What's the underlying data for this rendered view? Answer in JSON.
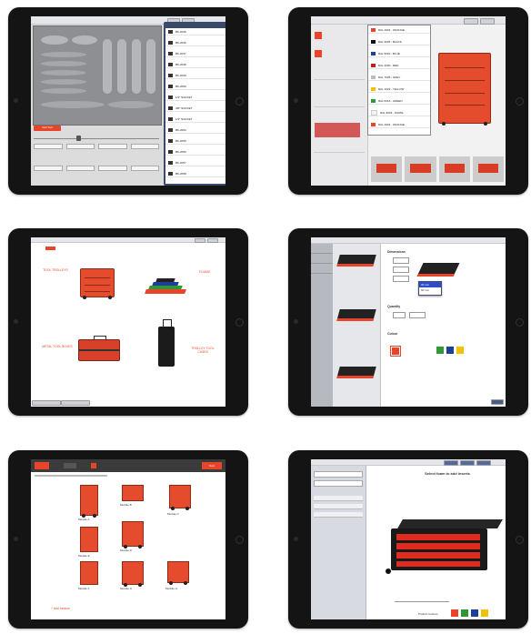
{
  "colors": {
    "frame": "#141414",
    "accent": "#e8442a",
    "panel": "#e5e6ea"
  },
  "screens": {
    "s1": {
      "name": "tool-layout-editor",
      "action_label": "Add Tool",
      "list_items": [
        {
          "label": "BK-2045"
        },
        {
          "label": "BK-2046"
        },
        {
          "label": "BK-2047"
        },
        {
          "label": "BK-2048"
        },
        {
          "label": "BK-2049"
        },
        {
          "label": "BK-2050"
        },
        {
          "label": "1/2\" SOCKET"
        },
        {
          "label": "3/8\" SOCKET"
        },
        {
          "label": "1/4\" SOCKET"
        },
        {
          "label": "BK-2054"
        },
        {
          "label": "BK-2055"
        },
        {
          "label": "BK-2056"
        },
        {
          "label": "BK-2057"
        },
        {
          "label": "BK-2058"
        }
      ]
    },
    "s2": {
      "name": "color-selection",
      "swatches": [
        {
          "label": "RAL 2004 - ORANGE",
          "color": "#e8442a"
        },
        {
          "label": "RAL 9005 - BLACK",
          "color": "#111111"
        },
        {
          "label": "RAL 5002 - BLUE",
          "color": "#1d3f9a"
        },
        {
          "label": "RAL 3000 - RED",
          "color": "#c81d1d"
        },
        {
          "label": "RAL 7035 - GREY",
          "color": "#b9bcc0"
        },
        {
          "label": "RAL 1023 - YELLOW",
          "color": "#f2c200"
        },
        {
          "label": "RAL 6018 - GREEN",
          "color": "#2f9a35"
        },
        {
          "label": "RAL 9003 - WHITE",
          "color": "#f4f4f4"
        },
        {
          "label": "RAL 2004 - ORANGE",
          "color": "#e8442a"
        }
      ]
    },
    "s3": {
      "name": "product-categories",
      "categories": [
        {
          "label": "TOOL TROLLEYS"
        },
        {
          "label": "FOAMS"
        },
        {
          "label": "METAL TOOL BOXES"
        },
        {
          "label": "TROLLEY TOOL CASES"
        }
      ]
    },
    "s4": {
      "name": "foam-configuration",
      "heading": "Dimensions",
      "quantity_label": "Quantity",
      "colour_label": "Colour",
      "dropdown_options": [
        "30 mm",
        "50 mm"
      ],
      "colour_swatches": [
        "#e8442a",
        "#2f9a35",
        "#1d3f9a",
        "#f2c200"
      ]
    },
    "s5": {
      "name": "module-selection",
      "action_label": "Next",
      "footer_link": "+ Add module",
      "modules": [
        {
          "label": "Module A"
        },
        {
          "label": "Module B"
        },
        {
          "label": "Module C"
        },
        {
          "label": "Module D"
        },
        {
          "label": "Module E"
        },
        {
          "label": "Module F"
        },
        {
          "label": "Module G"
        },
        {
          "label": "Module H"
        }
      ]
    },
    "s6": {
      "name": "drawer-configurator",
      "heading": "Select foam to add inserts",
      "footer_label": "Product Colours",
      "colour_swatches": [
        "#e8442a",
        "#2f9a35",
        "#1d3f9a",
        "#f2c200"
      ]
    }
  }
}
